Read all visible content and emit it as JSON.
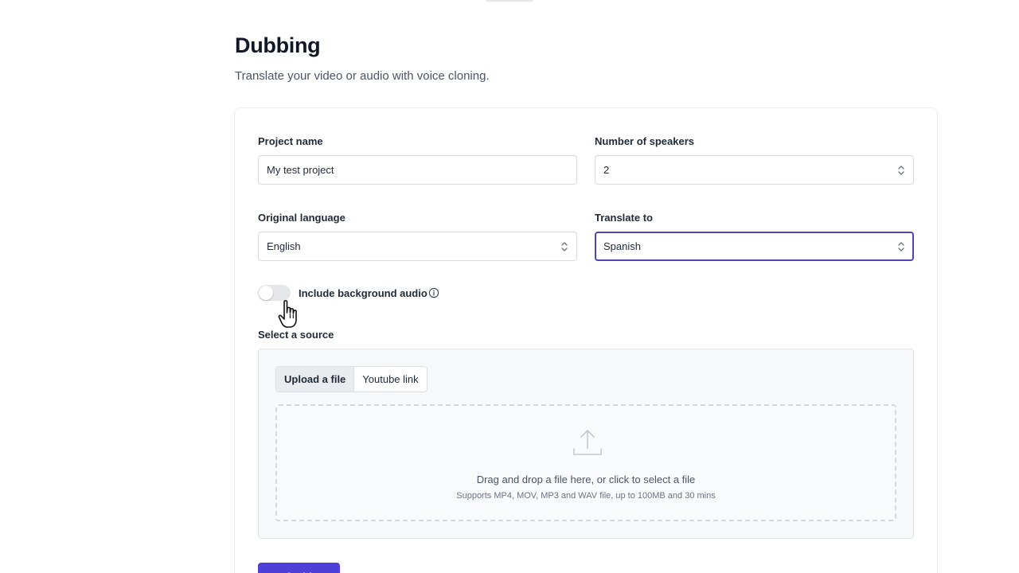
{
  "header": {
    "title": "Dubbing",
    "subtitle": "Translate your video or audio with voice cloning."
  },
  "form": {
    "project_name": {
      "label": "Project name",
      "value": "My test project"
    },
    "speakers": {
      "label": "Number of speakers",
      "value": "2"
    },
    "original_language": {
      "label": "Original language",
      "value": "English"
    },
    "translate_to": {
      "label": "Translate to",
      "value": "Spanish"
    },
    "background_audio": {
      "label": "Include background audio",
      "enabled": false
    }
  },
  "source": {
    "label": "Select a source",
    "tabs": [
      {
        "label": "Upload a file",
        "selected": true
      },
      {
        "label": "Youtube link",
        "selected": false
      }
    ],
    "dropzone": {
      "main_text": "Drag and drop a file here, or click to select a file",
      "sub_text": "Supports MP4, MOV, MP3 and WAV file, up to 100MB and 30 mins"
    }
  },
  "submit": {
    "label": "Dub video"
  },
  "colors": {
    "accent": "#4f3fd8",
    "active_border": "#4f46b5",
    "toggle_off": "#e5e7eb"
  },
  "icons": [
    "chevron-updown-icon",
    "info-icon",
    "upload-icon",
    "hand-cursor-icon"
  ]
}
